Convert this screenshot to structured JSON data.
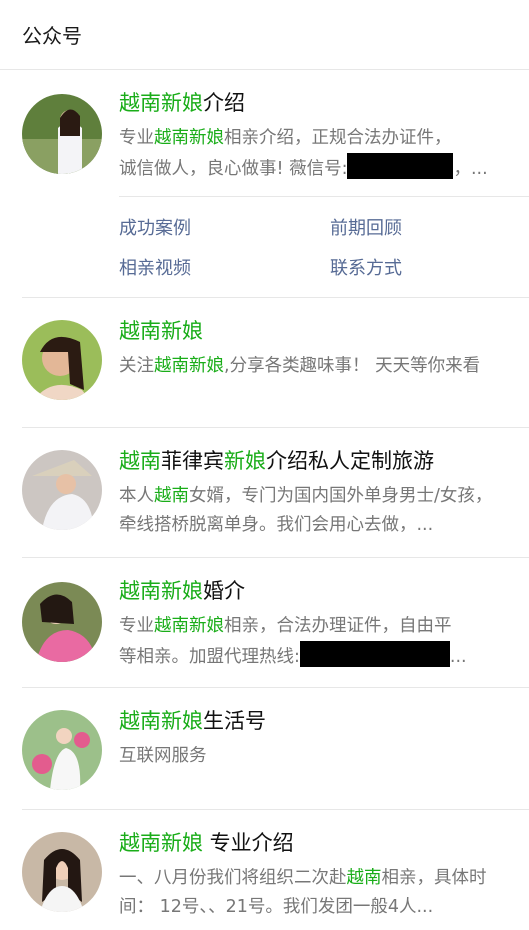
{
  "section": {
    "title": "公众号"
  },
  "results": [
    {
      "title_hl": "越南新娘",
      "title_rest": "介绍",
      "desc_line1_pre": "专业",
      "desc_line1_hl": "越南新娘",
      "desc_line1_post": "相亲介绍，正规合法办证件，",
      "desc_line2_pre": "诚信做人，良心做事! 薇信号:",
      "desc_line2_post": "，..."
    },
    {
      "title_hl": "越南新娘",
      "title_rest": "",
      "desc_pre": "关注",
      "desc_hl": "越南新娘",
      "desc_post": ",分享各类趣味事！ 天天等你来看"
    },
    {
      "title_hl1": "越南",
      "title_mid": "菲律宾",
      "title_hl2": "新娘",
      "title_rest": "介绍私人定制旅游",
      "desc_pre": "本人",
      "desc_hl": "越南",
      "desc_post": "女婿，专门为国内国外单身男士/女孩，牵线搭桥脱离单身。我们会用心去做，..."
    },
    {
      "title_hl": "越南新娘",
      "title_rest": "婚介",
      "desc_line1_pre": "专业",
      "desc_line1_hl": "越南新娘",
      "desc_line1_post": "相亲，合法办理证件，自由平",
      "desc_line2_pre": "等相亲。加盟代理热线:",
      "desc_line2_post": "..."
    },
    {
      "title_hl": "越南新娘",
      "title_rest": "生活号",
      "desc": "互联网服务"
    },
    {
      "title_hl": "越南新娘",
      "title_rest": " 专业介绍",
      "desc_pre": "一、八月份我们将组织二次赴",
      "desc_hl": "越南",
      "desc_post": "相亲，具体时间： 12号、、21号。我们发团一般4人..."
    }
  ],
  "menu": {
    "case": "成功案例",
    "review": "前期回顾",
    "video": "相亲视频",
    "contact": "联系方式"
  },
  "colors": {
    "highlight": "#1aad19",
    "link": "#576b95",
    "desc": "#777777",
    "divider": "#e7e7e7"
  }
}
